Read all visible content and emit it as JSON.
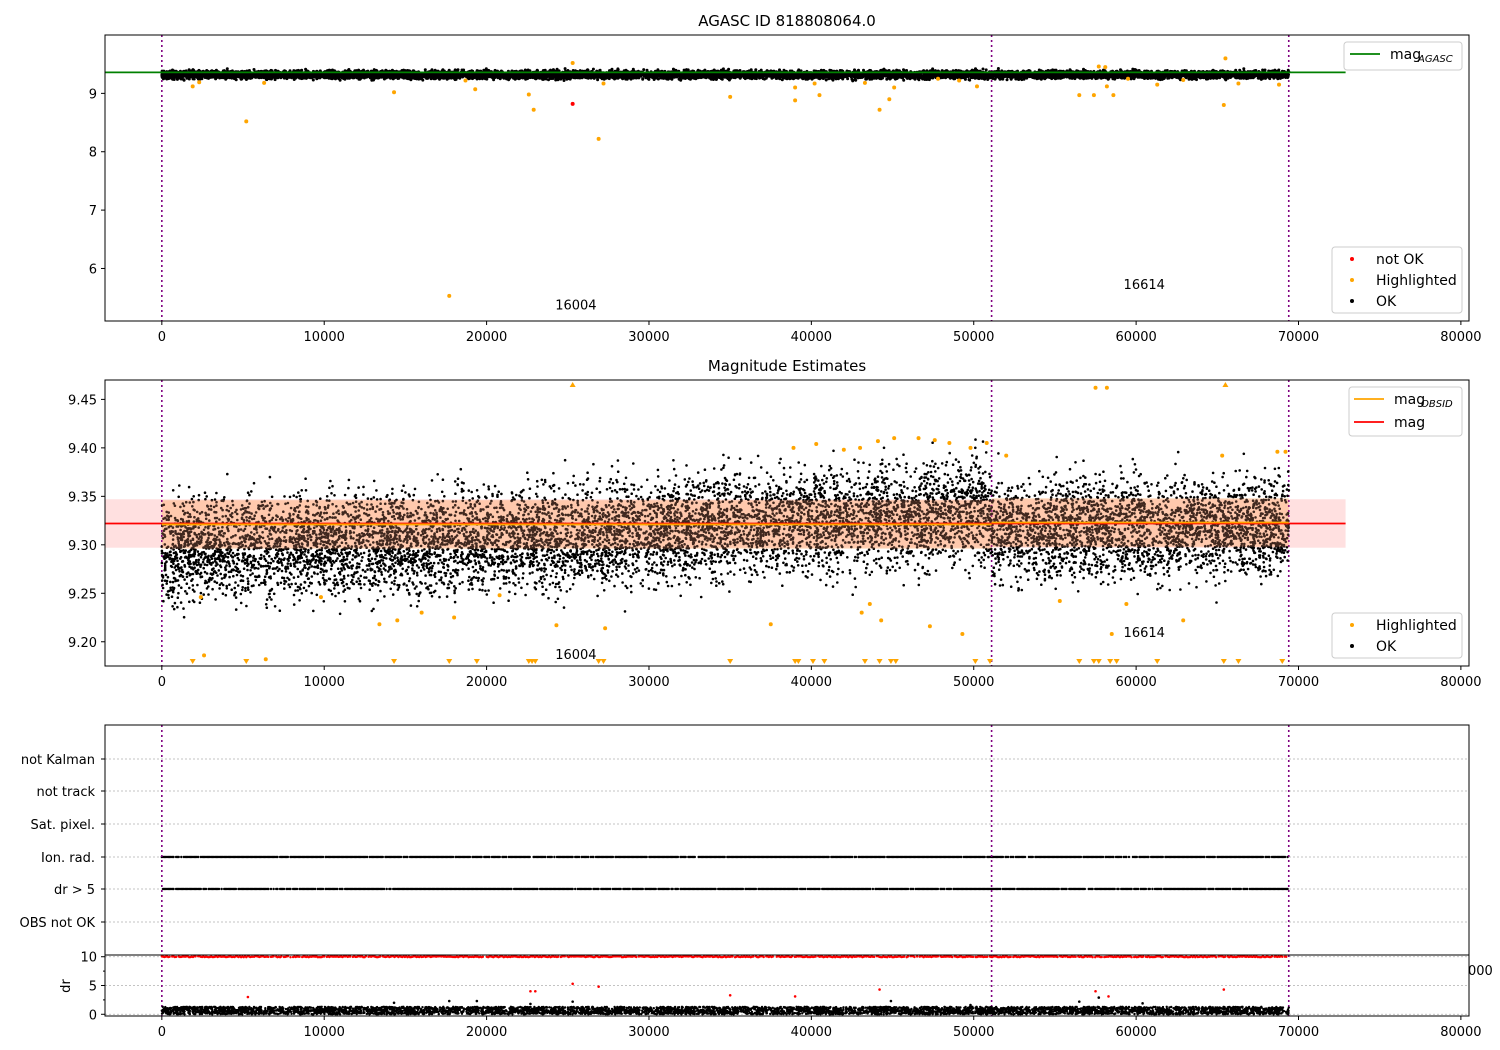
{
  "figure": {
    "title": "AGASC ID 818808064.0"
  },
  "chart_data": [
    {
      "type": "scatter",
      "title": "",
      "xlabel": "",
      "ylabel": "",
      "xlim": [
        -3500,
        80500
      ],
      "ylim": [
        5.1,
        10.0
      ],
      "xticks": [
        0,
        10000,
        20000,
        30000,
        40000,
        50000,
        60000,
        70000,
        80000
      ],
      "yticks": [
        6,
        7,
        8,
        9
      ],
      "obsid_boundaries": [
        0,
        51100,
        69400
      ],
      "reference_line": {
        "name": "mag_AGASC",
        "y": 9.36,
        "x_range": [
          -3500,
          72900
        ],
        "color": "#008000"
      },
      "annotations": [
        {
          "text": "16004",
          "x": 25500,
          "y": 5.3
        },
        {
          "text": "16614",
          "x": 60500,
          "y": 5.65
        }
      ],
      "ok_band": {
        "x_range": [
          0,
          69400
        ],
        "center": 9.32,
        "spread": 0.035
      },
      "series": [
        {
          "name": "not OK",
          "color": "#ff0000",
          "points": [
            [
              25300,
              8.82
            ]
          ]
        },
        {
          "name": "Highlighted",
          "color": "#ffa500",
          "points": [
            [
              1900,
              9.12
            ],
            [
              2300,
              9.19
            ],
            [
              5200,
              8.52
            ],
            [
              6300,
              9.18
            ],
            [
              14300,
              9.02
            ],
            [
              17700,
              5.53
            ],
            [
              18700,
              9.22
            ],
            [
              19300,
              9.07
            ],
            [
              22600,
              8.98
            ],
            [
              22900,
              8.72
            ],
            [
              25300,
              9.52
            ],
            [
              26900,
              8.22
            ],
            [
              27200,
              9.17
            ],
            [
              35000,
              8.94
            ],
            [
              39000,
              9.1
            ],
            [
              39000,
              8.88
            ],
            [
              40500,
              8.97
            ],
            [
              40200,
              9.17
            ],
            [
              43300,
              9.18
            ],
            [
              44200,
              8.72
            ],
            [
              44800,
              8.9
            ],
            [
              45100,
              9.1
            ],
            [
              47800,
              9.25
            ],
            [
              49100,
              9.22
            ],
            [
              50200,
              9.12
            ],
            [
              56500,
              8.97
            ],
            [
              57400,
              8.97
            ],
            [
              57700,
              9.46
            ],
            [
              58100,
              9.45
            ],
            [
              58200,
              9.12
            ],
            [
              58600,
              8.97
            ],
            [
              59500,
              9.25
            ],
            [
              61300,
              9.15
            ],
            [
              62900,
              9.23
            ],
            [
              65500,
              9.6
            ],
            [
              65400,
              8.8
            ],
            [
              66300,
              9.17
            ],
            [
              68800,
              9.15
            ]
          ]
        },
        {
          "name": "OK",
          "color": "#000000",
          "points": []
        }
      ],
      "legend": {
        "placement": "lower-right",
        "entries": [
          "not OK",
          "Highlighted",
          "OK"
        ]
      },
      "line_legend": {
        "placement": "upper-right",
        "entries": [
          {
            "label": "mag",
            "sub": "AGASC"
          }
        ]
      }
    },
    {
      "type": "scatter",
      "title": "Magnitude Estimates",
      "xlabel": "",
      "ylabel": "",
      "xlim": [
        -3500,
        80500
      ],
      "ylim": [
        9.175,
        9.47
      ],
      "xticks": [
        0,
        10000,
        20000,
        30000,
        40000,
        50000,
        60000,
        70000,
        80000
      ],
      "yticks": [
        9.2,
        9.25,
        9.3,
        9.35,
        9.4,
        9.45
      ],
      "obsid_boundaries": [
        0,
        51100,
        69400
      ],
      "mag_line": {
        "name": "mag",
        "y": 9.322,
        "x_range": [
          -3500,
          72900
        ],
        "color": "#ff0000",
        "band": [
          9.297,
          9.347
        ]
      },
      "mag_obsid": [
        {
          "x_range": [
            0,
            51100
          ],
          "y": 9.321,
          "band": [
            9.296,
            9.346
          ]
        },
        {
          "x_range": [
            51100,
            69400
          ],
          "y": 9.323,
          "band": [
            9.298,
            9.348
          ]
        }
      ],
      "annotations": [
        {
          "text": "16004",
          "x": 25500,
          "y": 9.182
        },
        {
          "text": "16614",
          "x": 60500,
          "y": 9.205
        }
      ],
      "ok_trend": [
        [
          0,
          9.295
        ],
        [
          20000,
          9.305
        ],
        [
          40000,
          9.325
        ],
        [
          51000,
          9.335
        ],
        [
          51200,
          9.315
        ],
        [
          69400,
          9.32
        ]
      ],
      "series": [
        {
          "name": "Highlighted",
          "color": "#ffa500",
          "points": [
            [
              2400,
              9.246
            ],
            [
              2600,
              9.186
            ],
            [
              6400,
              9.182
            ],
            [
              9800,
              9.246
            ],
            [
              13400,
              9.218
            ],
            [
              14500,
              9.222
            ],
            [
              16000,
              9.23
            ],
            [
              18000,
              9.225
            ],
            [
              20800,
              9.248
            ],
            [
              24300,
              9.217
            ],
            [
              27300,
              9.214
            ],
            [
              37500,
              9.218
            ],
            [
              43100,
              9.23
            ],
            [
              43600,
              9.239
            ],
            [
              44300,
              9.222
            ],
            [
              47300,
              9.216
            ],
            [
              49300,
              9.208
            ],
            [
              55300,
              9.242
            ],
            [
              57500,
              9.462
            ],
            [
              58200,
              9.462
            ],
            [
              58500,
              9.208
            ],
            [
              59400,
              9.239
            ],
            [
              62900,
              9.222
            ],
            [
              38900,
              9.4
            ],
            [
              40300,
              9.404
            ],
            [
              42000,
              9.398
            ],
            [
              43000,
              9.4
            ],
            [
              44100,
              9.407
            ],
            [
              45100,
              9.41
            ],
            [
              46600,
              9.41
            ],
            [
              47600,
              9.408
            ],
            [
              48500,
              9.405
            ],
            [
              49800,
              9.4
            ],
            [
              50800,
              9.405
            ],
            [
              52000,
              9.392
            ],
            [
              65300,
              9.392
            ],
            [
              68700,
              9.396
            ],
            [
              69200,
              9.396
            ]
          ]
        },
        {
          "name": "OK",
          "color": "#000000",
          "points": []
        }
      ],
      "clipped_low": [
        1900,
        5200,
        14300,
        17700,
        19400,
        22600,
        22800,
        23000,
        26900,
        27200,
        35000,
        39000,
        39200,
        40100,
        40800,
        43300,
        44200,
        44900,
        45200,
        50100,
        51000,
        56500,
        57400,
        57700,
        58400,
        58800,
        61300,
        65400,
        66300,
        69000
      ],
      "clipped_high": [
        25300,
        65500
      ],
      "legend": {
        "placement": "lower-right",
        "entries": [
          "Highlighted",
          "OK"
        ]
      },
      "line_legend": {
        "placement": "upper-right",
        "entries": [
          {
            "label": "mag",
            "sub": "OBSID"
          },
          {
            "label": "mag",
            "sub": ""
          }
        ]
      }
    },
    {
      "type": "scatter",
      "title": "",
      "xlabel": "",
      "ylabel": "",
      "xlim": [
        -3500,
        80500
      ],
      "categories": [
        "not Kalman",
        "not track",
        "Sat. pixel.",
        "Ion. rad.",
        "dr > 5",
        "OBS not OK"
      ],
      "flagged_rows": [
        "Ion. rad.",
        "dr > 5"
      ],
      "flag_x_range": [
        0,
        69400
      ],
      "obsid_boundaries": [
        0,
        51100,
        69400
      ],
      "grid": true
    },
    {
      "type": "scatter",
      "title": "",
      "xlabel": "",
      "ylabel": "dr",
      "xlim": [
        -3500,
        80500
      ],
      "ylim": [
        -0.3,
        10.3
      ],
      "xticks": [
        0,
        10000,
        20000,
        30000,
        40000,
        50000,
        60000,
        70000,
        80000
      ],
      "yticks": [
        0,
        5,
        10
      ],
      "clipped_tick_text": "000",
      "obsid_boundaries": [
        0,
        51100,
        69400
      ],
      "series": [
        {
          "name": "dr ok",
          "color": "#000000",
          "y_range": [
            0,
            1.3
          ]
        },
        {
          "name": "dr capped",
          "color": "#ff0000",
          "y": 10,
          "x_range": [
            0,
            69400
          ]
        },
        {
          "name": "dr high",
          "color": "#ff0000",
          "points": [
            [
              5300,
              3.0
            ],
            [
              22700,
              4.0
            ],
            [
              23000,
              4.0
            ],
            [
              25300,
              5.3
            ],
            [
              26900,
              4.8
            ],
            [
              35000,
              3.3
            ],
            [
              39000,
              3.1
            ],
            [
              44200,
              4.3
            ],
            [
              57500,
              4.0
            ],
            [
              58300,
              3.1
            ],
            [
              65400,
              4.3
            ]
          ]
        },
        {
          "name": "dr mid",
          "color": "#000000",
          "points": [
            [
              14300,
              2.0
            ],
            [
              17700,
              2.3
            ],
            [
              19400,
              2.3
            ],
            [
              22700,
              1.8
            ],
            [
              25300,
              2.2
            ],
            [
              44900,
              2.3
            ],
            [
              49800,
              1.6
            ],
            [
              56500,
              2.2
            ],
            [
              57700,
              2.9
            ],
            [
              60400,
              1.9
            ]
          ]
        }
      ]
    }
  ]
}
